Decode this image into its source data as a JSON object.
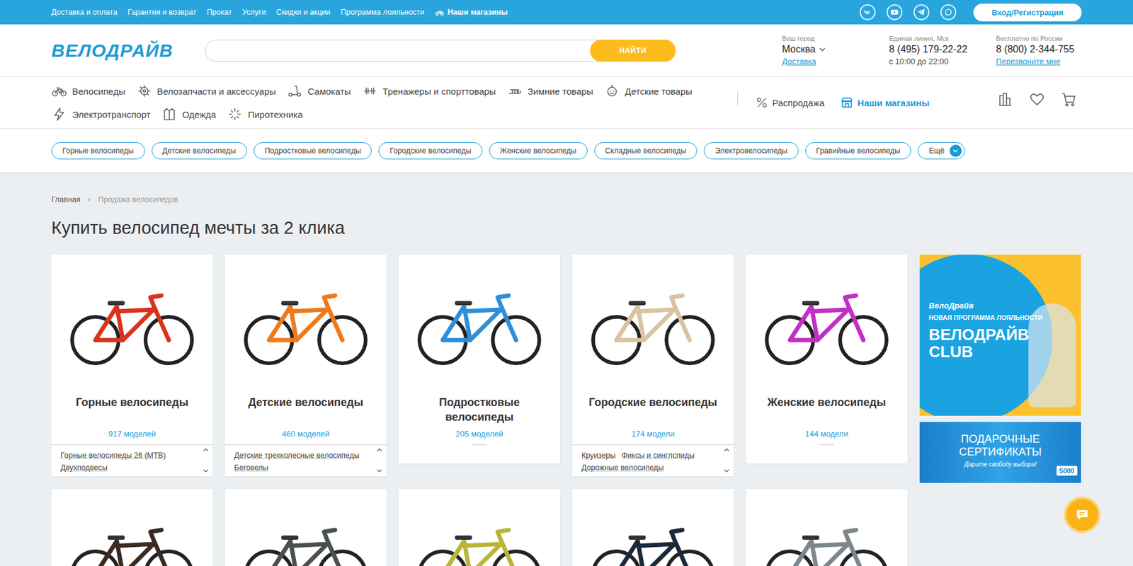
{
  "top_bar": {
    "links": [
      {
        "label": "Доставка и оплата"
      },
      {
        "label": "Гарантия и возврат"
      },
      {
        "label": "Прокат"
      },
      {
        "label": "Услуги"
      },
      {
        "label": "Скидки и акции"
      },
      {
        "label": "Программа лояльности"
      }
    ],
    "stores_link": "Наши магазины",
    "login_button": "Вход/Регистрация"
  },
  "header": {
    "logo": "ВЕЛОДРАЙВ",
    "search": {
      "placeholder": "",
      "button": "НАЙТИ"
    },
    "city": {
      "label": "Ваш город",
      "value": "Москва",
      "link": "Доставка"
    },
    "phones": [
      {
        "label": "Единая линия, Мск",
        "number": "8 (495) 179-22-22",
        "note": "с 10:00 до 22:00",
        "kind": "text"
      },
      {
        "label": "Бесплатно по России",
        "number": "8 (800) 2-344-755",
        "note": "Перезвоните мне",
        "kind": "link"
      }
    ]
  },
  "nav": {
    "items": [
      {
        "label": "Велосипеды"
      },
      {
        "label": "Велозапчасти и аксессуары"
      },
      {
        "label": "Самокаты"
      },
      {
        "label": "Тренажеры и спорттовары"
      },
      {
        "label": "Зимние товары"
      },
      {
        "label": "Детские товары"
      },
      {
        "label": "Электротранспорт"
      },
      {
        "label": "Одежда"
      },
      {
        "label": "Пиротехника"
      }
    ],
    "extras": [
      {
        "label": "Распродажа",
        "selected": false
      },
      {
        "label": "Наши магазины",
        "selected": true
      }
    ]
  },
  "chips": {
    "items": [
      "Горные велосипеды",
      "Детские велосипеды",
      "Подростковые велосипеды",
      "Городские велосипеды",
      "Женские велосипеды",
      "Складные велосипеды",
      "Электровелосипеды",
      "Гравийные велосипеды"
    ],
    "more": "Ещё"
  },
  "breadcrumb": [
    "Главная",
    "Продажа велосипедов"
  ],
  "title": "Купить велосипед мечты за 2 клика",
  "cards": [
    {
      "title": "Горные велосипеды",
      "count": "917 моделей",
      "sublinks": [
        "Горные велосипеды 26 (MTB)",
        "Двухподвесы"
      ],
      "color": "#d9331c"
    },
    {
      "title": "Детские велосипеды",
      "count": "460 моделей",
      "sublinks": [
        "Детские трехколесные велосипеды",
        "Беговелы"
      ],
      "color": "#f07a1a"
    },
    {
      "title": "Подростковые велосипеды",
      "count": "205 моделей",
      "sublinks": [],
      "color": "#2f8ed8"
    },
    {
      "title": "Городские велосипеды",
      "count": "174 модели",
      "sublinks": [
        "Круизеры",
        "Фиксы и синглспиды",
        "Дорожные велосипеды"
      ],
      "color": "#d9c3a2"
    },
    {
      "title": "Женские велосипеды",
      "count": "144 модели",
      "sublinks": [],
      "color": "#c22fc4"
    }
  ],
  "more_cards": [
    {
      "color": "#3a2a22"
    },
    {
      "color": "#4a4f52"
    },
    {
      "color": "#b9b53a"
    },
    {
      "color": "#1b2a3a"
    },
    {
      "color": "#7d868c"
    }
  ],
  "banners": {
    "loyalty": {
      "kicker": "ВелоДрайв",
      "subtitle": "НОВАЯ ПРОГРАММА ЛОЯЛЬНОСТИ",
      "title": "ВЕЛОДРАЙВ CLUB"
    },
    "gift": {
      "title": "ПОДАРОЧНЫЕ СЕРТИФИКАТЫ",
      "subtitle": "Дарите свободу выбора!",
      "badge": "5000"
    }
  }
}
